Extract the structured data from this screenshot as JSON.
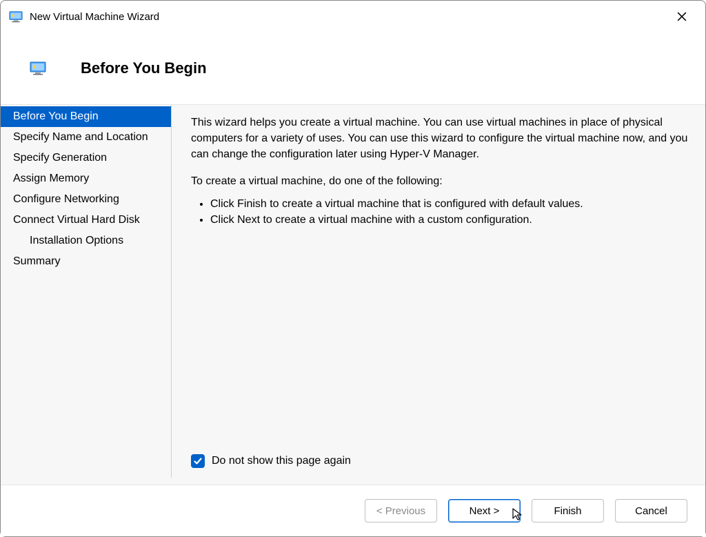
{
  "window": {
    "title": "New Virtual Machine Wizard"
  },
  "header": {
    "title": "Before You Begin"
  },
  "sidebar": {
    "steps": [
      {
        "label": "Before You Begin",
        "selected": true,
        "indent": false
      },
      {
        "label": "Specify Name and Location",
        "selected": false,
        "indent": false
      },
      {
        "label": "Specify Generation",
        "selected": false,
        "indent": false
      },
      {
        "label": "Assign Memory",
        "selected": false,
        "indent": false
      },
      {
        "label": "Configure Networking",
        "selected": false,
        "indent": false
      },
      {
        "label": "Connect Virtual Hard Disk",
        "selected": false,
        "indent": false
      },
      {
        "label": "Installation Options",
        "selected": false,
        "indent": true
      },
      {
        "label": "Summary",
        "selected": false,
        "indent": false
      }
    ]
  },
  "content": {
    "intro": "This wizard helps you create a virtual machine. You can use virtual machines in place of physical computers for a variety of uses. You can use this wizard to configure the virtual machine now, and you can change the configuration later using Hyper-V Manager.",
    "lead": "To create a virtual machine, do one of the following:",
    "bullets": [
      "Click Finish to create a virtual machine that is configured with default values.",
      "Click Next to create a virtual machine with a custom configuration."
    ],
    "dont_show_label": "Do not show this page again",
    "dont_show_checked": true
  },
  "buttons": {
    "previous": "< Previous",
    "next": "Next >",
    "finish": "Finish",
    "cancel": "Cancel"
  }
}
